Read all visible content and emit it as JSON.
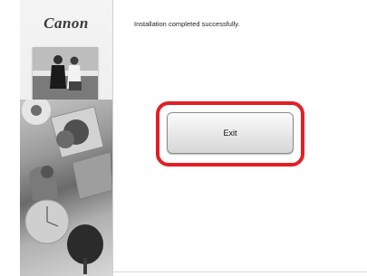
{
  "installer": {
    "brand": "Canon",
    "status_message": "Installation completed successfully.",
    "exit_label": "Exit"
  },
  "colors": {
    "highlight": "#e31e24"
  }
}
